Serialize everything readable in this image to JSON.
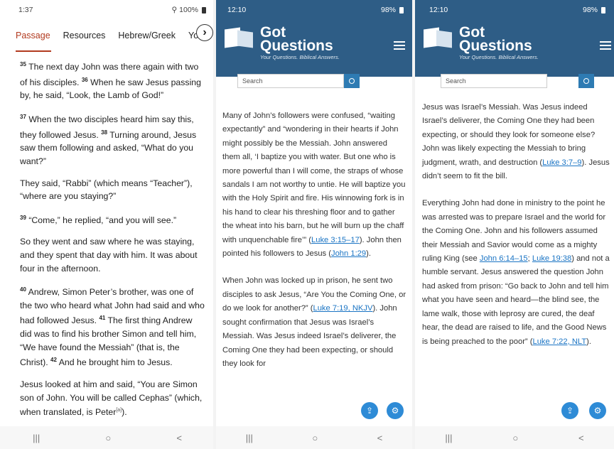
{
  "phone1": {
    "status": {
      "time": "1:37",
      "right": "100%"
    },
    "tabs": [
      "Passage",
      "Resources",
      "Hebrew/Greek",
      "Yo"
    ],
    "verses": [
      {
        "parts": [
          {
            "sup": "35"
          },
          {
            "t": " The next day John was there again with two of his disciples. "
          },
          {
            "sup": "36"
          },
          {
            "t": " When he saw Jesus passing by, he said, “Look, the Lamb of God!”"
          }
        ]
      },
      {
        "parts": [
          {
            "sup": "37"
          },
          {
            "t": " When the two disciples heard him say this, they followed Jesus. "
          },
          {
            "sup": "38"
          },
          {
            "t": " Turning around, Jesus saw them following and asked, “What do you want?”"
          }
        ]
      },
      {
        "parts": [
          {
            "t": "They said, “Rabbi” (which means “Teacher”), “where are you staying?”"
          }
        ]
      },
      {
        "parts": [
          {
            "sup": "39"
          },
          {
            "t": " “Come,” he replied, “and you will see.”"
          }
        ]
      },
      {
        "parts": [
          {
            "t": "So they went and saw where he was staying, and they spent that day with him. It was about four in the afternoon."
          }
        ]
      },
      {
        "parts": [
          {
            "sup": "40"
          },
          {
            "t": " Andrew, Simon Peter’s brother, was one of the two who heard what John had said and who had followed Jesus. "
          },
          {
            "sup": "41"
          },
          {
            "t": " The first thing Andrew did was to find his brother Simon and tell him, “We have found the Messiah” (that is, the Christ). "
          },
          {
            "sup": "42"
          },
          {
            "t": " And he brought him to Jesus."
          }
        ]
      },
      {
        "parts": [
          {
            "t": "Jesus looked at him and said, “You are Simon son of John. You will be called Cephas” (which, when translated, is Peter"
          },
          {
            "fn": "[a]"
          },
          {
            "t": ")."
          }
        ]
      }
    ]
  },
  "phone2": {
    "status": {
      "time": "12:10",
      "right": "98%"
    },
    "brand": {
      "line1": "Got",
      "line2": "Questions",
      "tagline": "Your Questions. Biblical Answers."
    },
    "search_placeholder": "Search",
    "paragraphs": [
      {
        "parts": [
          {
            "t": "Many of John’s followers were confused, “waiting expectantly” and “wondering in their hearts if John might possibly be the Messiah. John answered them all, ‘I baptize you with water. But one who is more powerful than I will come, the straps of whose sandals I am not worthy to untie. He will baptize you with the Holy Spirit and fire. His winnowing fork is in his hand to clear his threshing floor and to gather the wheat into his barn, but he will burn up the chaff with unquenchable fire’” ("
          },
          {
            "a": "Luke 3:15–17"
          },
          {
            "t": "). John then pointed his followers to Jesus ("
          },
          {
            "a": "John 1:29"
          },
          {
            "t": ")."
          }
        ]
      },
      {
        "parts": [
          {
            "t": "When John was locked up in prison, he sent two disciples to ask Jesus, “Are You the Coming One, or do we look for another?” ("
          },
          {
            "a": "Luke 7:19, NKJV"
          },
          {
            "t": "). John sought confirmation that Jesus was Israel’s Messiah. Was Jesus indeed Israel’s deliverer, the Coming One they had been expecting, or should they look for"
          }
        ]
      }
    ]
  },
  "phone3": {
    "status": {
      "time": "12:10",
      "right": "98%"
    },
    "brand": {
      "line1": "Got",
      "line2": "Questions",
      "tagline": "Your Questions. Biblical Answers."
    },
    "search_placeholder": "Search",
    "paragraphs": [
      {
        "parts": [
          {
            "t": "Jesus was Israel’s Messiah. Was Jesus indeed Israel’s deliverer, the Coming One they had been expecting, or should they look for someone else? John was likely expecting the Messiah to bring judgment, wrath, and destruction ("
          },
          {
            "a": "Luke 3:7–9"
          },
          {
            "t": "). Jesus didn’t seem to fit the bill."
          }
        ]
      },
      {
        "parts": [
          {
            "t": "Everything John had done in ministry to the point he was arrested was to prepare Israel and the world for the Coming One. John and his followers assumed their Messiah and Savior would come as a mighty ruling King (see "
          },
          {
            "a": "John 6:14–15"
          },
          {
            "t": "; "
          },
          {
            "a": "Luke 19:38"
          },
          {
            "t": ") and not a humble servant. Jesus answered the question John had asked from prison: “Go back to John and tell him what you have seen and heard—the blind see, the lame walk, those with leprosy are cured, the deaf hear, the dead are raised to life, and the Good News is being preached to the poor” ("
          },
          {
            "a": "Luke 7:22, NLT"
          },
          {
            "t": ")."
          }
        ]
      }
    ]
  },
  "nav": {
    "recent": "|||",
    "home": "○",
    "back": "<"
  },
  "colors": {
    "accent_tab": "#b23a1f",
    "gq_header": "#2e5d86",
    "link": "#1a74c4",
    "fab": "#2e8bd6"
  }
}
